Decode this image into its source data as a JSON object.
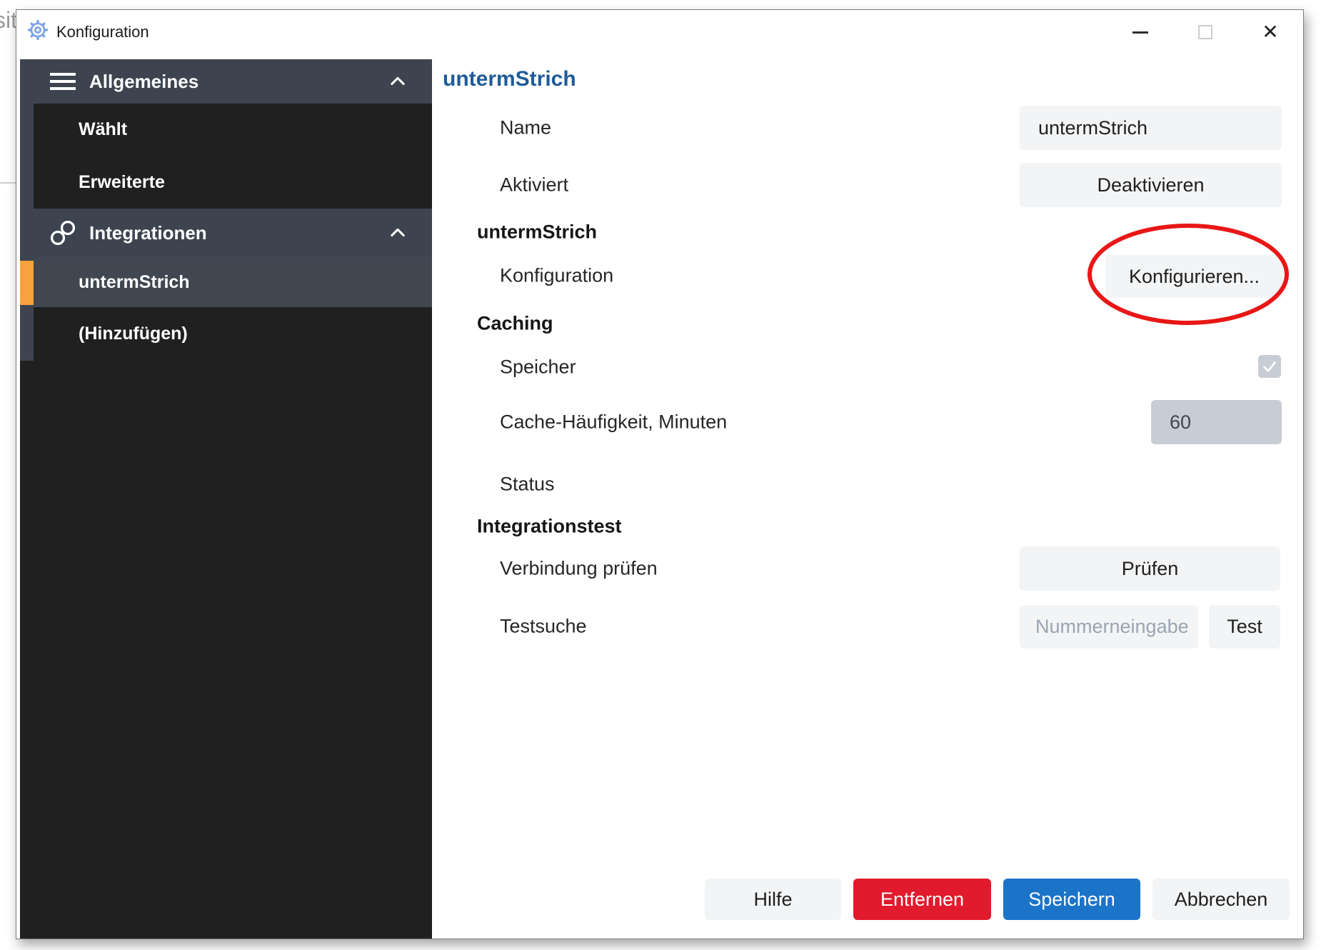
{
  "background": {
    "fragment": "sit"
  },
  "window": {
    "title": "Konfiguration"
  },
  "sidebar": {
    "groups": [
      {
        "label": "Allgemeines",
        "items": [
          {
            "label": "Wählt"
          },
          {
            "label": "Erweiterte"
          }
        ]
      },
      {
        "label": "Integrationen",
        "items": [
          {
            "label": "untermStrich",
            "selected": true
          },
          {
            "label": "(Hinzufügen)"
          }
        ]
      }
    ]
  },
  "main": {
    "title": "untermStrich",
    "rows": {
      "name": {
        "label": "Name",
        "value": "untermStrich"
      },
      "aktiviert": {
        "label": "Aktiviert",
        "button": "Deaktivieren"
      },
      "section_untermstrich": "untermStrich",
      "konfiguration": {
        "label": "Konfiguration",
        "button": "Konfigurieren..."
      },
      "section_caching": "Caching",
      "speicher": {
        "label": "Speicher",
        "checked": true
      },
      "cache": {
        "label": "Cache-Häufigkeit, Minuten",
        "value": "60"
      },
      "status": {
        "label": "Status"
      },
      "section_integrationstest": "Integrationstest",
      "verbindung": {
        "label": "Verbindung prüfen",
        "button": "Prüfen"
      },
      "testsuche": {
        "label": "Testsuche",
        "placeholder": "Nummerneingabe",
        "button": "Test"
      }
    }
  },
  "footer": {
    "hilfe": "Hilfe",
    "entfernen": "Entfernen",
    "speichern": "Speichern",
    "abbrechen": "Abbrechen"
  },
  "colors": {
    "sidebar_header_bg": "#3d4450",
    "sidebar_item_bg": "#202020",
    "sidebar_selected_bg": "#404750",
    "selection_accent_orange": "#f7a23c",
    "main_title_blue": "#1f5c99",
    "control_bg": "#f3f4f5",
    "disabled_control_bg": "#c8cdd5",
    "danger_red": "#e11b2d",
    "primary_blue": "#1b74c8",
    "annotation_red": "#e81717",
    "gear_icon_blue": "#7ca3e6"
  }
}
